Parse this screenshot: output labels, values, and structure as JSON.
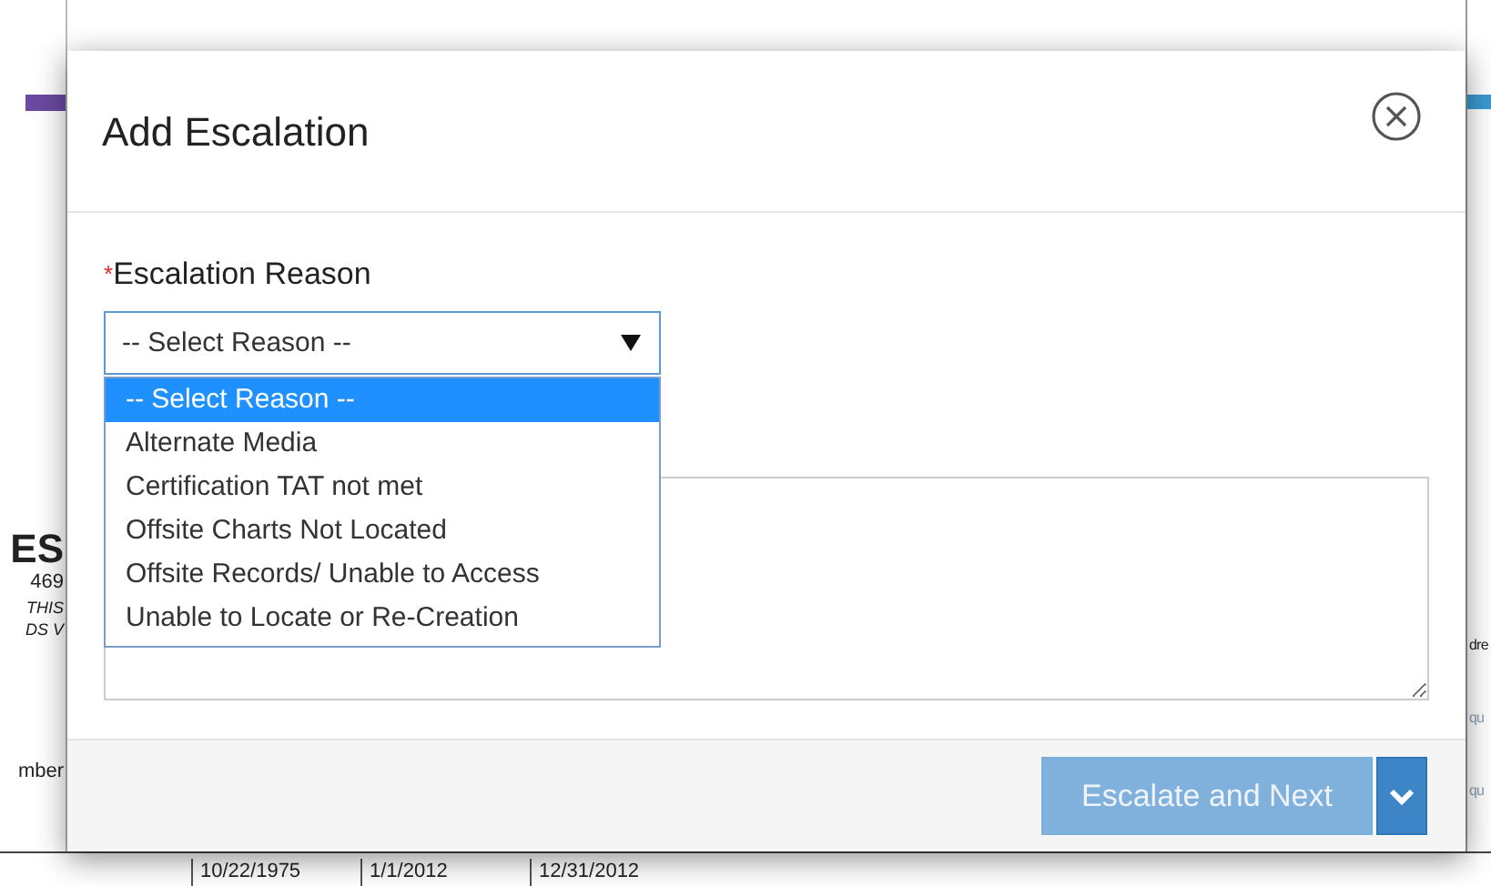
{
  "background": {
    "left_texts": [
      {
        "text": "ES",
        "kind": "heading"
      },
      {
        "text": "469",
        "kind": "plain"
      },
      {
        "text": "THIS",
        "kind": "note"
      },
      {
        "text": "DS V",
        "kind": "note"
      },
      {
        "text": "mber",
        "kind": "plain"
      }
    ],
    "bottom_cells": [
      "10/22/1975",
      "1/1/2012",
      "12/31/2012"
    ],
    "right_texts": [
      "dre",
      "qu",
      "qu"
    ]
  },
  "dialog": {
    "title": "Add Escalation",
    "reason_field": {
      "label": "Escalation Reason",
      "required_mark": "*",
      "value": "-- Select Reason --",
      "expanded": true
    },
    "options": [
      {
        "label": "-- Select Reason --",
        "selected": true
      },
      {
        "label": "Alternate Media",
        "selected": false
      },
      {
        "label": "Certification TAT not met",
        "selected": false
      },
      {
        "label": "Offsite Charts Not Located",
        "selected": false
      },
      {
        "label": "Offsite Records/ Unable to Access",
        "selected": false
      },
      {
        "label": "Unable to Locate or Re-Creation",
        "selected": false
      }
    ],
    "primary_button": {
      "label": "Escalate and Next",
      "disabled": true
    }
  }
}
